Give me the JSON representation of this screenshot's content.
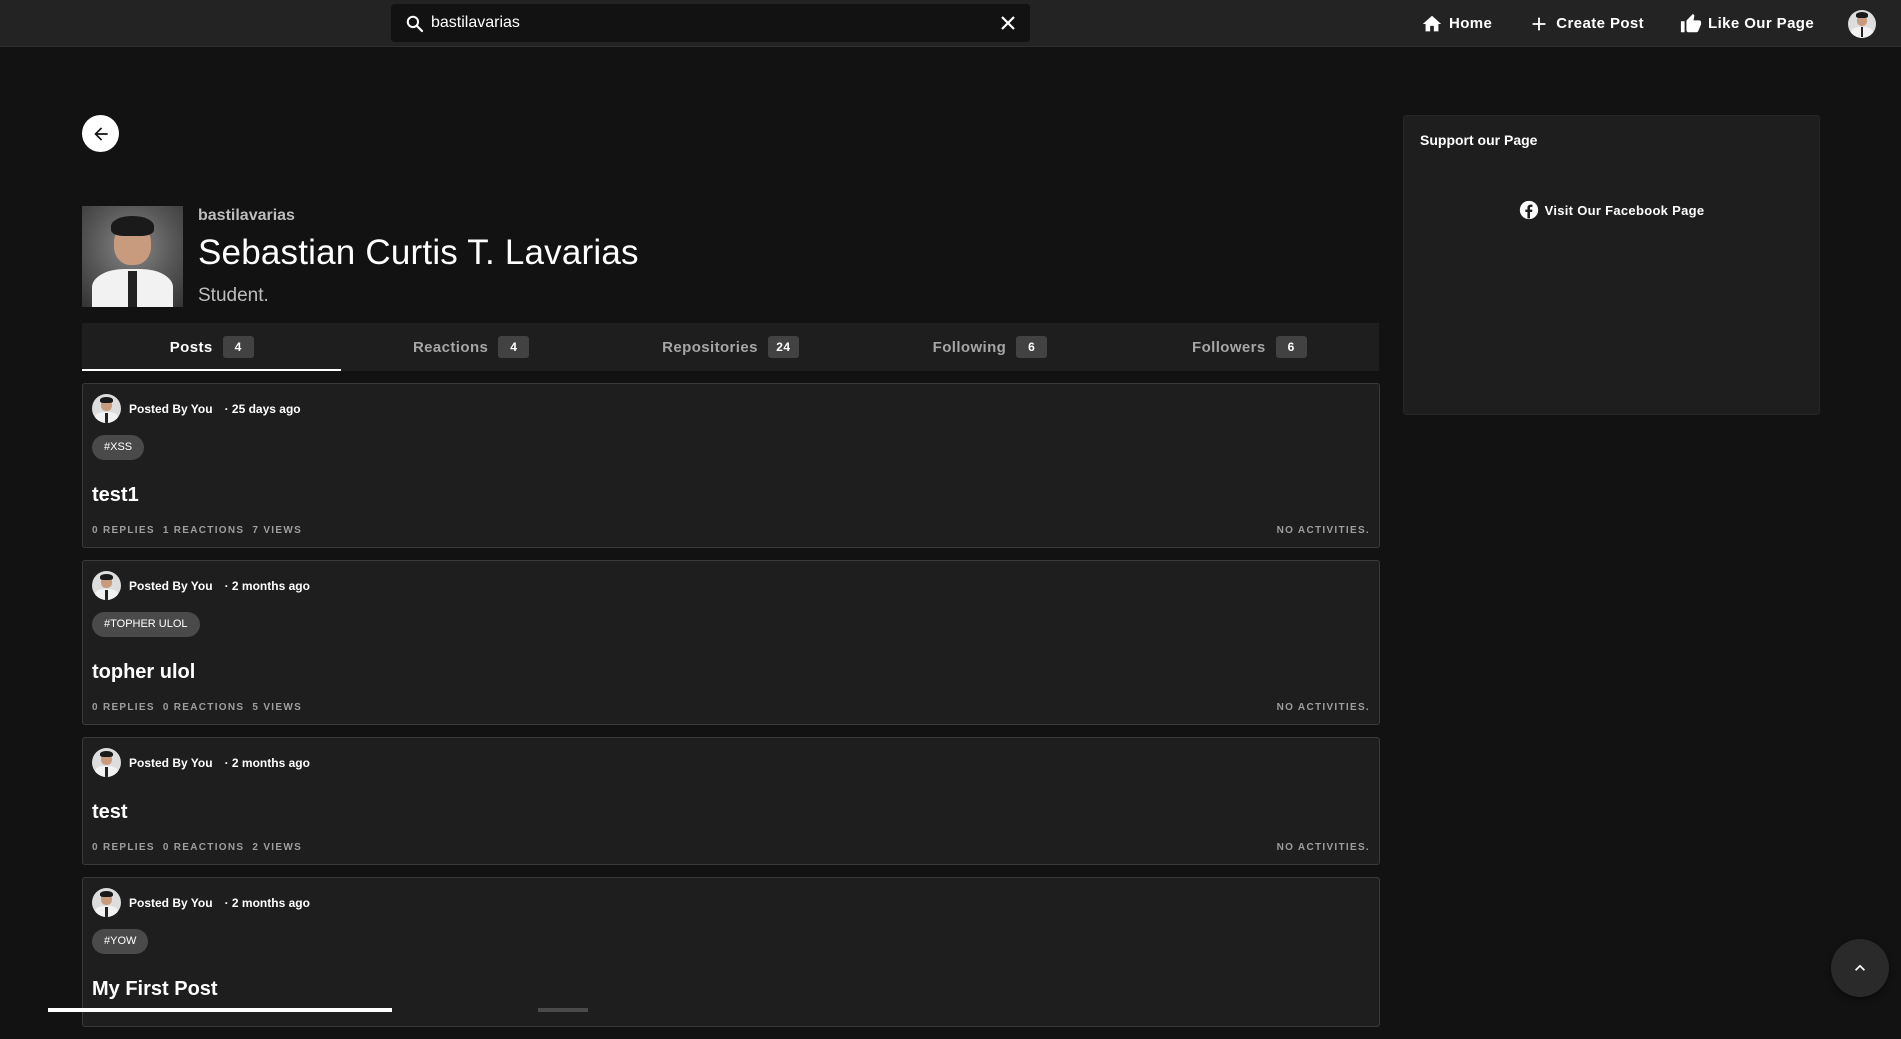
{
  "search": {
    "value": "bastilavarias"
  },
  "nav": {
    "home": "Home",
    "create_post": "Create Post",
    "like_page": "Like Our Page"
  },
  "profile": {
    "username": "bastilavarias",
    "full_name": "Sebastian Curtis T. Lavarias",
    "bio": "Student."
  },
  "tabs": [
    {
      "label": "Posts",
      "count": "4"
    },
    {
      "label": "Reactions",
      "count": "4"
    },
    {
      "label": "Repositories",
      "count": "24"
    },
    {
      "label": "Following",
      "count": "6"
    },
    {
      "label": "Followers",
      "count": "6"
    }
  ],
  "posts": [
    {
      "by": "Posted By You",
      "ago": "· 25 days ago",
      "tag": "#XSS",
      "title": "test1",
      "replies": "0 REPLIES",
      "reactions": "1 REACTIONS",
      "views": "7 VIEWS",
      "activity": "NO ACTIVITIES."
    },
    {
      "by": "Posted By You",
      "ago": "· 2 months ago",
      "tag": "#TOPHER ULOL",
      "title": "topher ulol",
      "replies": "0 REPLIES",
      "reactions": "0 REACTIONS",
      "views": "5 VIEWS",
      "activity": "NO ACTIVITIES."
    },
    {
      "by": "Posted By You",
      "ago": "· 2 months ago",
      "tag": "",
      "title": "test",
      "replies": "0 REPLIES",
      "reactions": "0 REACTIONS",
      "views": "2 VIEWS",
      "activity": "NO ACTIVITIES."
    },
    {
      "by": "Posted By You",
      "ago": "· 2 months ago",
      "tag": "#YOW",
      "title": "My First Post",
      "replies": "",
      "reactions": "",
      "views": "",
      "activity": ""
    }
  ],
  "support": {
    "title": "Support our Page",
    "link": "Visit Our Facebook Page"
  },
  "icons": {
    "search": "search-icon",
    "clear": "close-icon",
    "home": "home-icon",
    "create": "plus-icon",
    "like": "thumbs-up-icon",
    "back": "arrow-left-icon",
    "facebook": "facebook-icon",
    "scroll_top": "chevron-up-icon"
  }
}
